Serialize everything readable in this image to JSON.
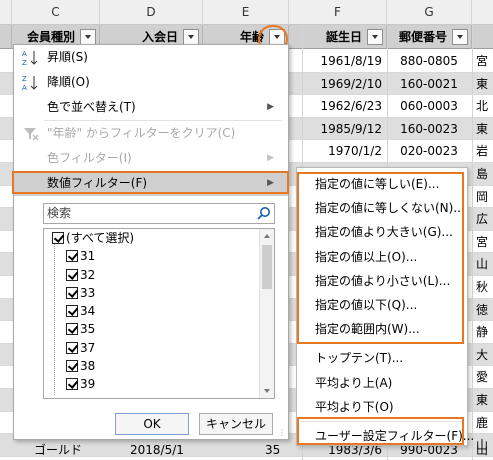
{
  "sheet": {
    "columns": [
      "C",
      "D",
      "E",
      "F",
      "G"
    ],
    "headers": {
      "member_type": "会員種別",
      "join_date": "入会日",
      "age": "年齢",
      "birthday": "誕生日",
      "postal_code": "郵便番号"
    },
    "rows": [
      {
        "birthday": "1961/8/19",
        "zip": "880-0805",
        "addr": "宮"
      },
      {
        "birthday": "1969/2/10",
        "zip": "160-0021",
        "addr": "東"
      },
      {
        "birthday": "1962/6/23",
        "zip": "060-0003",
        "addr": "北"
      },
      {
        "birthday": "1985/9/12",
        "zip": "160-0023",
        "addr": "東"
      },
      {
        "birthday": "1970/1/2",
        "zip": "020-0023",
        "addr": "岩"
      },
      {
        "birthday": "1967/8/14",
        "zip": "690-0003",
        "addr": "島"
      },
      {
        "birthday": "",
        "zip": "",
        "addr": "岡"
      },
      {
        "birthday": "",
        "zip": "",
        "addr": "広"
      },
      {
        "birthday": "",
        "zip": "",
        "addr": "宮"
      },
      {
        "birthday": "",
        "zip": "",
        "addr": "山"
      },
      {
        "birthday": "",
        "zip": "",
        "addr": "秋"
      },
      {
        "birthday": "",
        "zip": "",
        "addr": "徳"
      },
      {
        "birthday": "",
        "zip": "",
        "addr": "静"
      },
      {
        "birthday": "",
        "zip": "",
        "addr": "大"
      },
      {
        "birthday": "",
        "zip": "",
        "addr": "愛"
      },
      {
        "birthday": "",
        "zip": "",
        "addr": "東"
      },
      {
        "birthday": "",
        "zip": "",
        "addr": "鹿"
      },
      {
        "birthday": "",
        "zip": "",
        "addr": "山"
      }
    ],
    "bottom_row": {
      "member_type": "ゴールド",
      "join_date": "2018/5/1",
      "age": "35",
      "birthday": "1983/3/6",
      "zip": "990-0023",
      "addr": "山"
    }
  },
  "filter_menu": {
    "sort_asc": "昇順(S)",
    "sort_desc": "降順(O)",
    "sort_by_color": "色で並べ替え(T)",
    "clear_filter": "\"年齢\" からフィルターをクリア(C)",
    "color_filter": "色フィルター(I)",
    "number_filter": "数値フィルター(F)",
    "search_placeholder": "検索",
    "values": [
      "(すべて選択)",
      "31",
      "32",
      "33",
      "34",
      "35",
      "37",
      "38",
      "39"
    ],
    "ok": "OK",
    "cancel": "キャンセル"
  },
  "number_filter_submenu": {
    "items_boxed": [
      "指定の値に等しい(E)...",
      "指定の値に等しくない(N)...",
      "指定の値より大きい(G)...",
      "指定の値以上(O)...",
      "指定の値より小さい(L)...",
      "指定の値以下(Q)...",
      "指定の範囲内(W)..."
    ],
    "items_other": [
      "トップテン(T)...",
      "平均より上(A)",
      "平均より下(O)"
    ],
    "custom_filter": "ユーザー設定フィルター(F)..."
  },
  "colors": {
    "highlight_outline": "#e87722",
    "header_fill": "#d0d0d0",
    "row_shade": "#dedede"
  },
  "icons": [
    "sort-ascending-icon",
    "sort-descending-icon",
    "clear-filter-icon",
    "search-icon",
    "dropdown-arrow-icon",
    "submenu-arrow-icon",
    "checkbox-checked-icon"
  ]
}
